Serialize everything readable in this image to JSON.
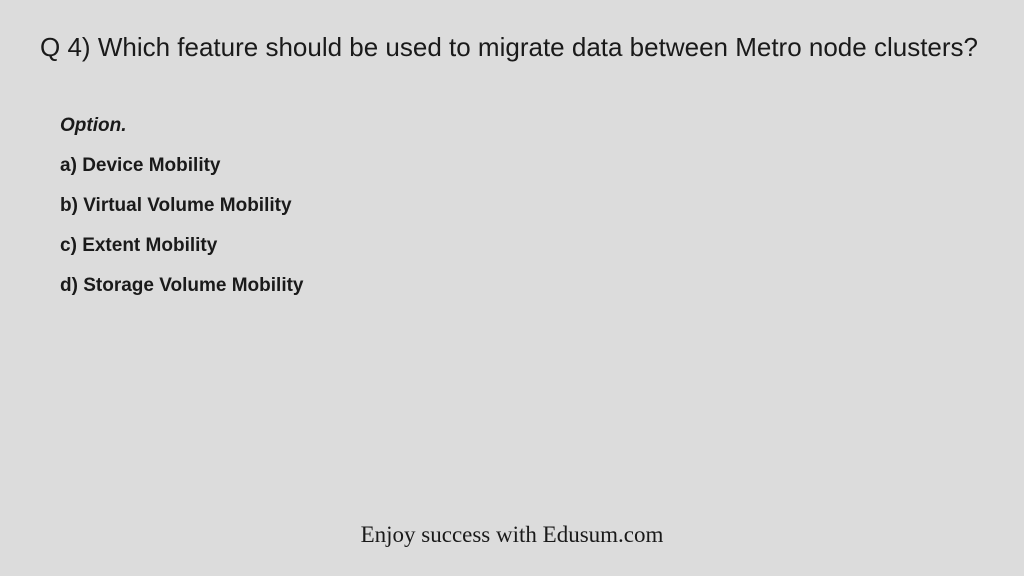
{
  "question": {
    "prefix": "Q 4)",
    "text": "Which feature should be used to migrate data between Metro node clusters?"
  },
  "optionHeader": "Option.",
  "options": [
    {
      "letter": "a)",
      "text": "Device Mobility"
    },
    {
      "letter": "b)",
      "text": "Virtual Volume Mobility"
    },
    {
      "letter": "c)",
      "text": "Extent Mobility"
    },
    {
      "letter": "d)",
      "text": "Storage Volume Mobility"
    }
  ],
  "footer": "Enjoy success with Edusum.com"
}
